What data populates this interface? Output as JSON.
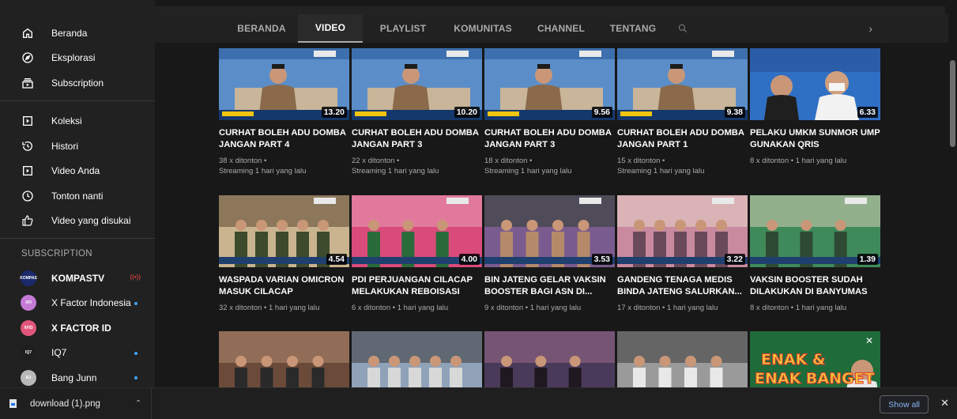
{
  "sidebar": {
    "items": [
      {
        "label": "Beranda",
        "icon": "home-icon"
      },
      {
        "label": "Eksplorasi",
        "icon": "compass-icon"
      },
      {
        "label": "Subscription",
        "icon": "subscriptions-icon"
      }
    ],
    "library": [
      {
        "label": "Koleksi",
        "icon": "library-icon"
      },
      {
        "label": "Histori",
        "icon": "history-icon"
      },
      {
        "label": "Video Anda",
        "icon": "play-icon"
      },
      {
        "label": "Tonton nanti",
        "icon": "clock-icon"
      },
      {
        "label": "Video yang disukai",
        "icon": "thumbs-up-icon"
      }
    ],
    "subscription_heading": "SUBSCRIPTION",
    "subscriptions": [
      {
        "name": "KOMPASTV",
        "avatar_text": "KOMPAS",
        "avatar_color": "#1b2a6b",
        "badge": "live",
        "live_text": "((•))"
      },
      {
        "name": "X Factor Indonesia",
        "avatar_text": "XFI",
        "avatar_color": "#c57bd6",
        "badge": "dot"
      },
      {
        "name": "X FACTOR ID",
        "avatar_text": "XFID",
        "avatar_color": "#e0567a",
        "badge": ""
      },
      {
        "name": "IQ7",
        "avatar_text": "IQ7",
        "avatar_color": "#1e1e1e",
        "badge": "dot"
      },
      {
        "name": "Bang Junn",
        "avatar_text": "BJ",
        "avatar_color": "#b9b9b9",
        "badge": "dot"
      }
    ]
  },
  "tabs": [
    {
      "label": "BERANDA",
      "active": false
    },
    {
      "label": "VIDEO",
      "active": true
    },
    {
      "label": "PLAYLIST",
      "active": false
    },
    {
      "label": "KOMUNITAS",
      "active": false
    },
    {
      "label": "CHANNEL",
      "active": false
    },
    {
      "label": "TENTANG",
      "active": false
    }
  ],
  "tabs_next_glyph": "›",
  "videos": [
    [
      {
        "title": "CURHAT BOLEH ADU DOMBA JANGAN PART 4",
        "duration": "13.20",
        "meta1": "38 x ditonton •",
        "meta2": "Streaming 1 hari yang lalu",
        "palette": [
          "#5b8ec9",
          "#8a6a4a",
          "#2b2b2b"
        ]
      },
      {
        "title": "CURHAT BOLEH ADU DOMBA JANGAN PART 3",
        "duration": "10.20",
        "meta1": "22 x ditonton •",
        "meta2": "Streaming 1 hari yang lalu",
        "palette": [
          "#5b8ec9",
          "#8a6a4a",
          "#2b2b2b"
        ]
      },
      {
        "title": "CURHAT BOLEH ADU DOMBA JANGAN PART 3",
        "duration": "9.56",
        "meta1": "18 x ditonton •",
        "meta2": "Streaming 1 hari yang lalu",
        "palette": [
          "#5b8ec9",
          "#8a6a4a",
          "#2b2b2b"
        ]
      },
      {
        "title": "CURHAT BOLEH ADU DOMBA JANGAN PART 1",
        "duration": "9.38",
        "meta1": "15 x ditonton •",
        "meta2": "Streaming 1 hari yang lalu",
        "palette": [
          "#5b8ec9",
          "#8a6a4a",
          "#2b2b2b"
        ]
      },
      {
        "title": "PELAKU UMKM SUNMOR UMP GUNAKAN QRIS",
        "duration": "6.33",
        "meta1": "8 x ditonton • 1 hari yang lalu",
        "meta2": "",
        "palette": [
          "#2f6fc4",
          "#f2f2f2",
          "#c0392b"
        ]
      }
    ],
    [
      {
        "title": "WASPADA VARIAN OMICRON MASUK CILACAP",
        "duration": "4.54",
        "meta1": "32 x ditonton • 1 hari yang lalu",
        "meta2": "",
        "palette": [
          "#c9b48f",
          "#5a4632",
          "#3d4a2c"
        ]
      },
      {
        "title": "PDI PERJUANGAN CILACAP MELAKUKAN REBOISASI",
        "duration": "4.00",
        "meta1": "6 x ditonton • 1 hari yang lalu",
        "meta2": "",
        "palette": [
          "#d94b7a",
          "#e7a0b8",
          "#2a6b3a"
        ]
      },
      {
        "title": "BIN JATENG GELAR VAKSIN BOOSTER BAGI ASN DI...",
        "duration": "3.53",
        "meta1": "9 x ditonton • 1 hari yang lalu",
        "meta2": "",
        "palette": [
          "#7a5b8f",
          "#2c3e2e",
          "#b58a6a"
        ]
      },
      {
        "title": "GANDENG TENAGA MEDIS BINDA JATENG SALURKAN...",
        "duration": "3.22",
        "meta1": "17 x ditonton • 1 hari yang lalu",
        "meta2": "",
        "palette": [
          "#c98aa0",
          "#e6d6c6",
          "#6a4a5a"
        ]
      },
      {
        "title": "VAKSIN BOOSTER SUDAH DILAKUKAN DI BANYUMAS",
        "duration": "1.39",
        "meta1": "8 x ditonton • 1 hari yang lalu",
        "meta2": "",
        "palette": [
          "#3f8a5a",
          "#d8cfb8",
          "#2e4a34"
        ]
      }
    ],
    [
      {
        "title": "",
        "duration": "",
        "meta1": "",
        "meta2": "",
        "palette": [
          "#6b4a3a",
          "#b08a70",
          "#2a2a2a"
        ]
      },
      {
        "title": "",
        "duration": "",
        "meta1": "",
        "meta2": "",
        "palette": [
          "#8fa2b8",
          "#3a3a3a",
          "#d8d8d8"
        ]
      },
      {
        "title": "",
        "duration": "",
        "meta1": "",
        "meta2": "",
        "palette": [
          "#4a3a5a",
          "#9b6a8a",
          "#201820"
        ]
      },
      {
        "title": "",
        "duration": "",
        "meta1": "",
        "meta2": "",
        "palette": [
          "#9a9a9a",
          "#3a3a3a",
          "#e8e8e8"
        ]
      },
      {
        "title": "",
        "duration": "",
        "meta1": "",
        "meta2": "",
        "palette": [
          "#1f6b3a",
          "#f2c53d",
          "#e23b2a"
        ],
        "overlay": "ENAK & ENAK BANGET"
      }
    ]
  ],
  "download": {
    "filename": "download (1).png",
    "show_all": "Show all"
  },
  "colors": {
    "accent_blue": "#3ea6ff",
    "live_red": "#ff4e45"
  }
}
